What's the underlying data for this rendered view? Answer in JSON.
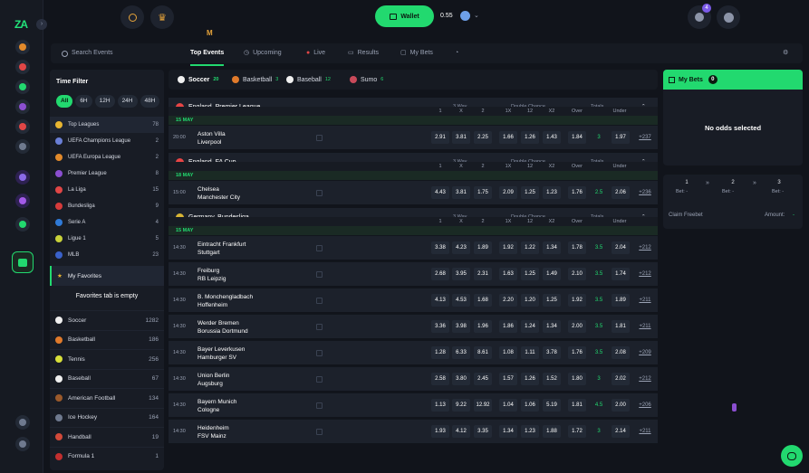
{
  "brand": {
    "logo": "ZA\nZA"
  },
  "header": {
    "wallet_label": "Wallet",
    "balance": "0.55",
    "notif_count": "4",
    "logo_mark": "M"
  },
  "nav": {
    "search_placeholder": "Search Events",
    "tabs": [
      {
        "label": "Top Events"
      },
      {
        "label": "Upcoming"
      },
      {
        "label": "Live"
      },
      {
        "label": "Results"
      },
      {
        "label": "My Bets"
      }
    ]
  },
  "sidebar": {
    "time_filter_title": "Time Filter",
    "time_chips": [
      "All",
      "6H",
      "12H",
      "24H",
      "48H"
    ],
    "leagues": [
      {
        "name": "Top Leagues",
        "count": "78",
        "color": "#e8b531"
      },
      {
        "name": "UEFA Champions League",
        "count": "2",
        "color": "#6a7fd6"
      },
      {
        "name": "UEFA Europa League",
        "count": "2",
        "color": "#e28a2b"
      },
      {
        "name": "Premier League",
        "count": "8",
        "color": "#8b4fd0"
      },
      {
        "name": "La Liga",
        "count": "15",
        "color": "#e04646"
      },
      {
        "name": "Bundesliga",
        "count": "9",
        "color": "#d63b3b"
      },
      {
        "name": "Serie A",
        "count": "4",
        "color": "#2f7ad8"
      },
      {
        "name": "Ligue 1",
        "count": "5",
        "color": "#c9d23a"
      },
      {
        "name": "MLB",
        "count": "23",
        "color": "#3a61c9"
      }
    ],
    "favorites_label": "My Favorites",
    "favorites_empty": "Favorites tab is empty",
    "sports": [
      {
        "name": "Soccer",
        "count": "1282",
        "color": "#f0f0f0"
      },
      {
        "name": "Basketball",
        "count": "186",
        "color": "#e07a2b"
      },
      {
        "name": "Tennis",
        "count": "256",
        "color": "#d8e03a"
      },
      {
        "name": "Baseball",
        "count": "67",
        "color": "#f0f0f0"
      },
      {
        "name": "American Football",
        "count": "134",
        "color": "#9b5a2b"
      },
      {
        "name": "Ice Hockey",
        "count": "164",
        "color": "#6f7a8f"
      },
      {
        "name": "Handball",
        "count": "19",
        "color": "#d24a3a"
      },
      {
        "name": "Formula 1",
        "count": "1",
        "color": "#c22f2f"
      }
    ]
  },
  "sport_tabs": [
    {
      "label": "Soccer",
      "count": "20",
      "color": "#f0f0f0"
    },
    {
      "label": "Basketball",
      "count": "3",
      "color": "#e07a2b"
    },
    {
      "label": "Baseball",
      "count": "12",
      "color": "#f0f0f0"
    },
    {
      "label": "Sumo",
      "count": "6",
      "color": "#c94a5a"
    }
  ],
  "market_headers": {
    "three_way": "3 Way",
    "double_chance": "Double Chance",
    "totals": "Totals",
    "cols": [
      "1",
      "X",
      "2",
      "1X",
      "12",
      "X2",
      "Over",
      "Under"
    ]
  },
  "leagues": [
    {
      "name": "England, Premier League",
      "flag": "#e84545",
      "date": "15 MAY",
      "matches": [
        {
          "time": "20:00",
          "home": "Aston Villa",
          "away": "Liverpool",
          "odds": [
            "2.91",
            "3.81",
            "2.25",
            "1.66",
            "1.26",
            "1.43",
            "1.84",
            "3",
            "1.97"
          ],
          "more": "+237"
        }
      ]
    },
    {
      "name": "England, FA Cup",
      "flag": "#e84545",
      "date": "18 MAY",
      "matches": [
        {
          "time": "15:00",
          "home": "Chelsea",
          "away": "Manchester City",
          "odds": [
            "4.43",
            "3.81",
            "1.75",
            "2.09",
            "1.25",
            "1.23",
            "1.76",
            "2.5",
            "2.06"
          ],
          "more": "+236"
        }
      ]
    },
    {
      "name": "Germany, Bundesliga",
      "flag": "#d8b535",
      "date": "15 MAY",
      "matches": [
        {
          "time": "14:30",
          "home": "Eintracht Frankfurt",
          "away": "Stuttgart",
          "odds": [
            "3.38",
            "4.23",
            "1.89",
            "1.92",
            "1.22",
            "1.34",
            "1.78",
            "3.5",
            "2.04"
          ],
          "more": "+212"
        },
        {
          "time": "14:30",
          "home": "Freiburg",
          "away": "RB Leipzig",
          "odds": [
            "2.68",
            "3.95",
            "2.31",
            "1.63",
            "1.25",
            "1.49",
            "2.10",
            "3.5",
            "1.74"
          ],
          "more": "+212"
        },
        {
          "time": "14:30",
          "home": "B. Monchengladbach",
          "away": "Hoffenheim",
          "odds": [
            "4.13",
            "4.53",
            "1.68",
            "2.20",
            "1.20",
            "1.25",
            "1.92",
            "3.5",
            "1.89"
          ],
          "more": "+211"
        },
        {
          "time": "14:30",
          "home": "Werder Bremen",
          "away": "Borussia Dortmund",
          "odds": [
            "3.36",
            "3.98",
            "1.96",
            "1.86",
            "1.24",
            "1.34",
            "2.00",
            "3.5",
            "1.81"
          ],
          "more": "+211"
        },
        {
          "time": "14:30",
          "home": "Bayer Leverkusen",
          "away": "Hamburger SV",
          "odds": [
            "1.28",
            "6.33",
            "8.61",
            "1.08",
            "1.11",
            "3.78",
            "1.76",
            "3.5",
            "2.08"
          ],
          "more": "+209"
        },
        {
          "time": "14:30",
          "home": "Union Berlin",
          "away": "Augsburg",
          "odds": [
            "2.58",
            "3.80",
            "2.45",
            "1.57",
            "1.26",
            "1.52",
            "1.80",
            "3",
            "2.02"
          ],
          "more": "+212"
        },
        {
          "time": "14:30",
          "home": "Bayern Munich",
          "away": "Cologne",
          "odds": [
            "1.13",
            "9.22",
            "12.92",
            "1.04",
            "1.06",
            "5.19",
            "1.81",
            "4.5",
            "2.00"
          ],
          "more": "+206"
        },
        {
          "time": "14:30",
          "home": "Heidenheim",
          "away": "FSV Mainz",
          "odds": [
            "1.93",
            "4.12",
            "3.35",
            "1.34",
            "1.23",
            "1.88",
            "1.72",
            "3",
            "2.14"
          ],
          "more": "+211"
        }
      ]
    }
  ],
  "betslip": {
    "title": "My Bets",
    "count": "0",
    "empty": "No odds selected",
    "steps": [
      {
        "num": "1",
        "label": "Bet: -"
      },
      {
        "num": "2",
        "label": "Bet: -"
      },
      {
        "num": "3",
        "label": "Bet: -"
      }
    ],
    "claim_label": "Claim Freebet",
    "amount_label": "Amount:",
    "amount_value": "-"
  }
}
